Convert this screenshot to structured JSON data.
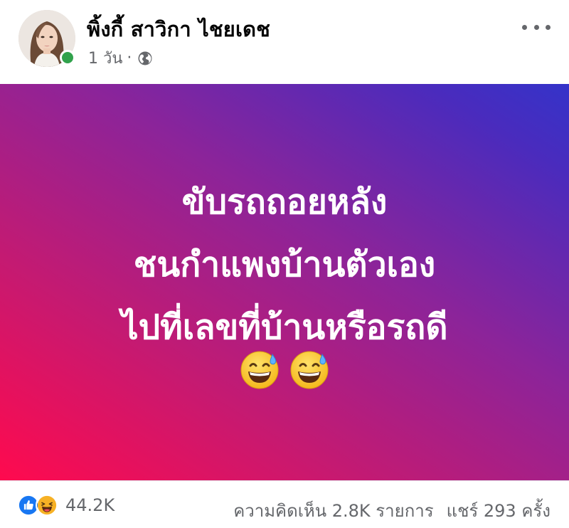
{
  "post": {
    "author": {
      "name": "พิ้งกี้ สาวิกา ไชยเดช",
      "online": true,
      "avatar_icon": "profile-photo"
    },
    "meta": {
      "time": "1 วัน",
      "separator": "·",
      "privacy_icon": "globe-icon"
    },
    "more_icon": "more-options-icon",
    "background": {
      "gradient_colors": [
        "#ff0a4e",
        "#c41a72",
        "#8b249a",
        "#4a2bbd",
        "#3433c9"
      ]
    },
    "text_lines": [
      "ขับรถถอยหลัง",
      "ชนกำแพงบ้านตัวเอง",
      "ไปที่เลขที่บ้านหรือรถดี"
    ],
    "emojis": [
      "grinning-face-with-sweat",
      "grinning-face-with-sweat"
    ]
  },
  "footer": {
    "reaction_icons": [
      "like-icon",
      "haha-icon"
    ],
    "reaction_count": "44.2K",
    "comments": "ความคิดเห็น 2.8K รายการ",
    "shares": "แชร์ 293 ครั้ง"
  },
  "colors": {
    "name_text": "#050505",
    "meta_text": "#65676b",
    "online_dot": "#31a24c",
    "like_blue": "#1877f2",
    "haha_yellow": "#f7b125"
  }
}
